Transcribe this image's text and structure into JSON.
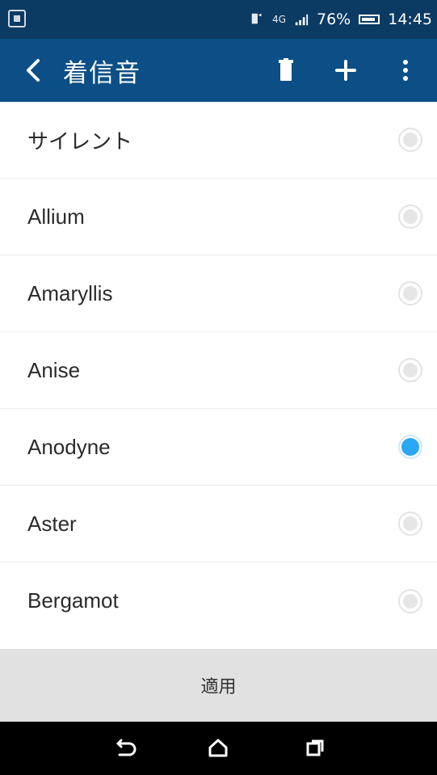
{
  "status_bar": {
    "battery_text": "76%",
    "time": "14:45",
    "network_text": "4G"
  },
  "app_bar": {
    "title": "着信音"
  },
  "ringtones": [
    {
      "label": "サイレント",
      "selected": false
    },
    {
      "label": "Allium",
      "selected": false
    },
    {
      "label": "Amaryllis",
      "selected": false
    },
    {
      "label": "Anise",
      "selected": false
    },
    {
      "label": "Anodyne",
      "selected": true
    },
    {
      "label": "Aster",
      "selected": false
    },
    {
      "label": "Bergamot",
      "selected": false
    }
  ],
  "apply_button": {
    "label": "適用"
  },
  "colors": {
    "status_bar_bg": "#0b3a63",
    "app_bar_bg": "#0b4f86",
    "selected_radio": "#2aa7f5",
    "apply_bg": "#e1e1e1"
  },
  "icons": {
    "status_left": "notification-icon",
    "back": "back-chevron-icon",
    "delete": "trash-icon",
    "add": "plus-icon",
    "more": "more-vert-icon",
    "nav_back": "nav-back-icon",
    "nav_home": "nav-home-icon",
    "nav_recents": "nav-recents-icon"
  }
}
